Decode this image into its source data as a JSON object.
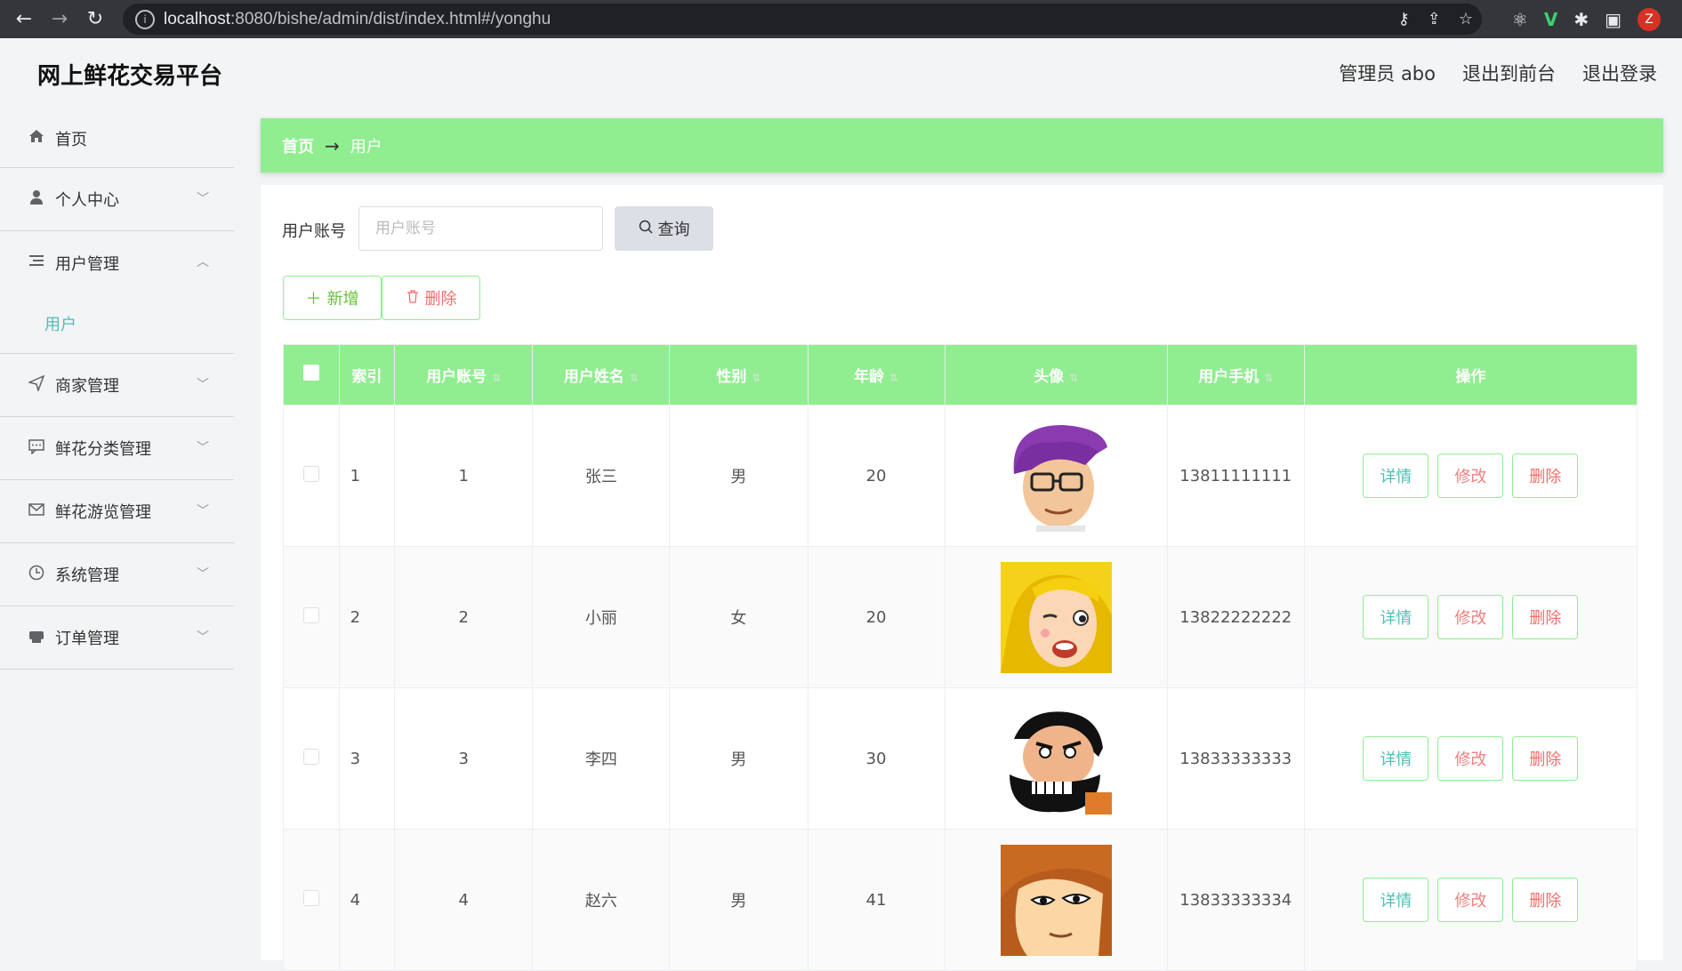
{
  "browser": {
    "url_host": "localhost",
    "url_rest": ":8080/bishe/admin/dist/index.html#/yonghu",
    "ext_avatar": "Z"
  },
  "header": {
    "brand": "网上鲜花交易平台",
    "admin": "管理员 abo",
    "to_front": "退出到前台",
    "logout": "退出登录"
  },
  "sidebar": {
    "items": [
      {
        "label": "首页",
        "icon": "home-icon"
      },
      {
        "label": "个人中心",
        "icon": "user-icon"
      },
      {
        "label": "用户管理",
        "icon": "list-icon"
      },
      {
        "label": "商家管理",
        "icon": "send-icon"
      },
      {
        "label": "鲜花分类管理",
        "icon": "chat-icon"
      },
      {
        "label": "鲜花游览管理",
        "icon": "mail-icon"
      },
      {
        "label": "系统管理",
        "icon": "clock-icon"
      },
      {
        "label": "订单管理",
        "icon": "printer-icon"
      }
    ],
    "submenu_user": "用户"
  },
  "breadcrumb": {
    "home": "首页",
    "current": "用户"
  },
  "search": {
    "label": "用户账号",
    "placeholder": "用户账号",
    "button": "查询"
  },
  "actions": {
    "add": "新增",
    "delete": "删除"
  },
  "table": {
    "columns": [
      "索引",
      "用户账号",
      "用户姓名",
      "性别",
      "年龄",
      "头像",
      "用户手机",
      "操作"
    ],
    "rows": [
      {
        "index": "1",
        "account": "1",
        "name": "张三",
        "gender": "男",
        "age": "20",
        "phone": "13811111111"
      },
      {
        "index": "2",
        "account": "2",
        "name": "小丽",
        "gender": "女",
        "age": "20",
        "phone": "13822222222"
      },
      {
        "index": "3",
        "account": "3",
        "name": "李四",
        "gender": "男",
        "age": "30",
        "phone": "13833333333"
      },
      {
        "index": "4",
        "account": "4",
        "name": "赵六",
        "gender": "男",
        "age": "41",
        "phone": "13833333334"
      }
    ],
    "op_labels": {
      "detail": "详情",
      "edit": "修改",
      "remove": "删除"
    }
  },
  "colors": {
    "accent_green": "#90ee90",
    "teal": "#4dc0b5",
    "danger": "#f56c6c"
  }
}
